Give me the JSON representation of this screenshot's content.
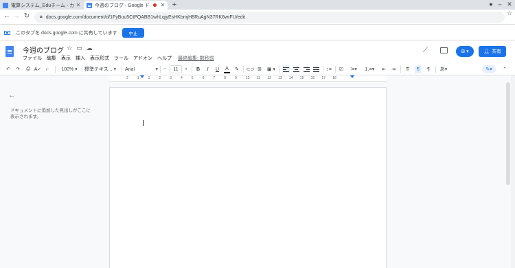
{
  "browser": {
    "tabs": [
      {
        "title": "電算システム_Eduチーム - カ",
        "active": false
      },
      {
        "title": "今週のブログ - Google ド",
        "active": true
      }
    ],
    "new_tab": "+",
    "url": "docs.google.com/document/d/1FyBuu5CtPQABB1whLqjyEsHKbmjH8RuAgN37RK6wrFU/edit"
  },
  "share_notice": {
    "message": "このタブを docs.google.com に共有しています",
    "stop_label": "中止"
  },
  "docs": {
    "title": "今週のブログ",
    "menu": [
      "ファイル",
      "編集",
      "表示",
      "挿入",
      "表示形式",
      "ツール",
      "アドオン",
      "ヘルプ"
    ],
    "last_edit": "最終編集: 数秒前",
    "share_label": "共有"
  },
  "toolbar": {
    "zoom": "100%",
    "style": "標準テキス...",
    "font": "Arial",
    "font_size": "11",
    "bold": "B",
    "italic": "I",
    "underline": "U",
    "text_color": "A",
    "input_tools": "あ"
  },
  "ruler": {
    "numbers": [
      "2",
      "1",
      "1",
      "2",
      "3",
      "4",
      "5",
      "6",
      "7",
      "8",
      "9",
      "10",
      "11",
      "12",
      "13",
      "14",
      "15",
      "16",
      "17",
      "18"
    ]
  },
  "outline": {
    "hint": "ドキュメントに追加した見出しがここに表示されます。"
  },
  "colors": {
    "accent": "#1a73e8",
    "docs_blue": "#4285f4"
  }
}
